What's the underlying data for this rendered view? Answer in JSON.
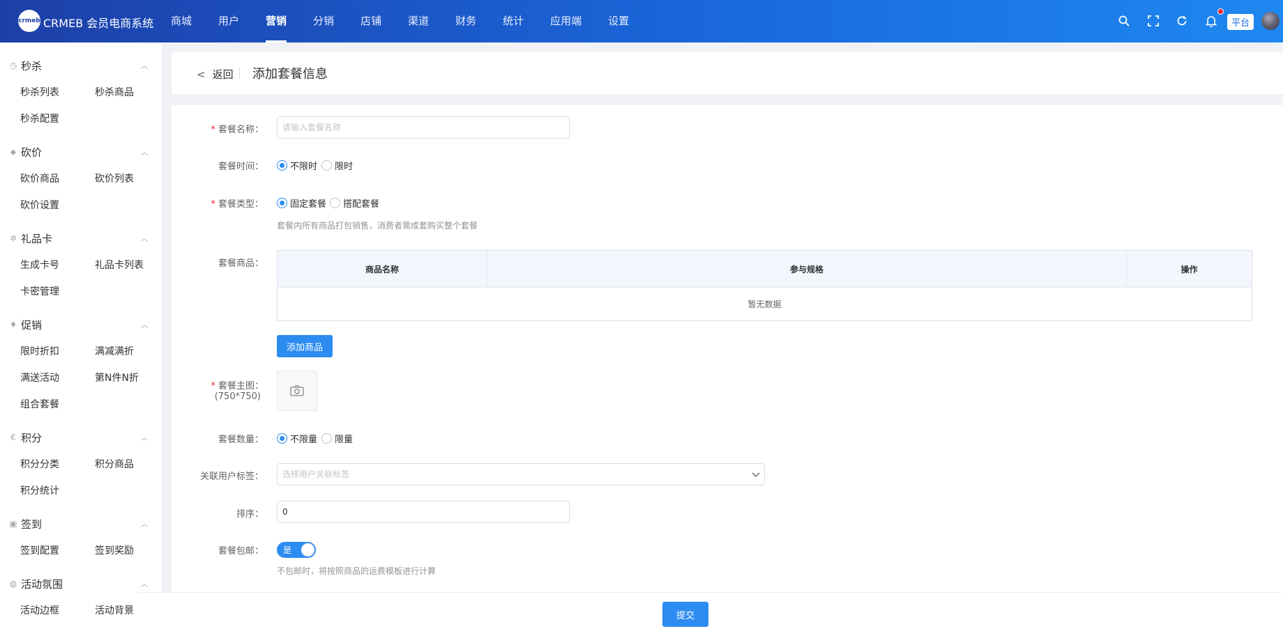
{
  "header": {
    "logo_text": "crmeb",
    "brand": "CRMEB 会员电商系统",
    "nav": [
      {
        "label": "商城"
      },
      {
        "label": "用户"
      },
      {
        "label": "营销",
        "active": true
      },
      {
        "label": "分销"
      },
      {
        "label": "店铺"
      },
      {
        "label": "渠道"
      },
      {
        "label": "财务"
      },
      {
        "label": "统计"
      },
      {
        "label": "应用端"
      },
      {
        "label": "设置"
      }
    ],
    "icons": [
      "search-icon",
      "fullscreen-icon",
      "refresh-icon",
      "bell-icon"
    ],
    "platform_badge": "平台",
    "avatar": "avatar"
  },
  "sidebar": {
    "groups": [
      {
        "icon": "clock-icon",
        "title": "秒杀",
        "items": [
          "秒杀列表",
          "秒杀商品",
          "秒杀配置"
        ]
      },
      {
        "icon": "tag-icon",
        "title": "砍价",
        "items": [
          "砍价商品",
          "砍价列表",
          "砍价设置"
        ]
      },
      {
        "icon": "gear-icon",
        "title": "礼品卡",
        "items": [
          "生成卡号",
          "礼品卡列表",
          "卡密管理"
        ]
      },
      {
        "icon": "mic-icon",
        "title": "促销",
        "items": [
          "限时折扣",
          "满减满折",
          "满送活动",
          "第N件N折",
          "组合套餐"
        ]
      },
      {
        "icon": "euro-icon",
        "title": "积分",
        "items": [
          "积分分类",
          "积分商品",
          "积分统计"
        ]
      },
      {
        "icon": "calendar-icon",
        "title": "签到",
        "items": [
          "签到配置",
          "签到奖励"
        ]
      },
      {
        "icon": "circle-icon",
        "title": "活动氛围",
        "items": [
          "活动边框",
          "活动背景"
        ]
      }
    ]
  },
  "crumb": {
    "back_label": "返回",
    "title": "添加套餐信息"
  },
  "form": {
    "name": {
      "label": "套餐名称：",
      "placeholder": "请输入套餐名称"
    },
    "time": {
      "label": "套餐时间：",
      "options": [
        "不限时",
        "限时"
      ],
      "selected": 0
    },
    "type": {
      "label": "套餐类型：",
      "options": [
        "固定套餐",
        "搭配套餐"
      ],
      "selected": 0,
      "hint": "套餐内所有商品打包销售，消费者需成套购买整个套餐"
    },
    "products": {
      "label": "套餐商品：",
      "columns": [
        "商品名称",
        "参与规格",
        "操作"
      ],
      "empty_text": "暂无数据",
      "add_button": "添加商品"
    },
    "image": {
      "label": "套餐主图：",
      "size_hint": "(750*750)"
    },
    "quantity": {
      "label": "套餐数量：",
      "options": [
        "不限量",
        "限量"
      ],
      "selected": 0
    },
    "user_tag": {
      "label": "关联用户标签：",
      "placeholder": "选择用户关联标签"
    },
    "sort": {
      "label": "排序：",
      "value": "0"
    },
    "shipping": {
      "label": "套餐包邮：",
      "switch_text": "是",
      "switch_on": true,
      "hint": "不包邮时，将按照商品的运费模板进行计算"
    }
  },
  "footer": {
    "submit_label": "提交"
  },
  "colors": {
    "primary": "#2d8cf0",
    "header_start": "#1d3fa8",
    "header_end": "#1e88f0",
    "required": "#f5222d"
  }
}
